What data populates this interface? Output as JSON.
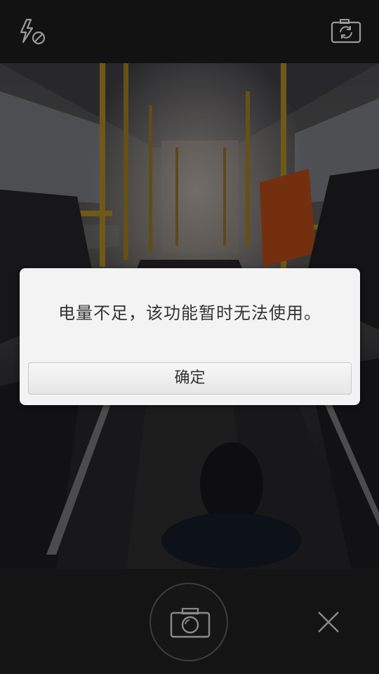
{
  "top_bar": {
    "flash_icon": "flash-off-icon",
    "switch_icon": "camera-switch-icon"
  },
  "dialog": {
    "message": "电量不足，该功能暂时无法使用。",
    "confirm_label": "确定"
  },
  "bottom_bar": {
    "shutter_icon": "camera-icon",
    "close_icon": "close-icon"
  },
  "colors": {
    "dialog_bg": "#f3f3f3",
    "bar_bg": "#121212",
    "icon_color": "#9a9a9a",
    "accent_yellow": "#c9a22a",
    "accent_orange": "#d4571c"
  }
}
